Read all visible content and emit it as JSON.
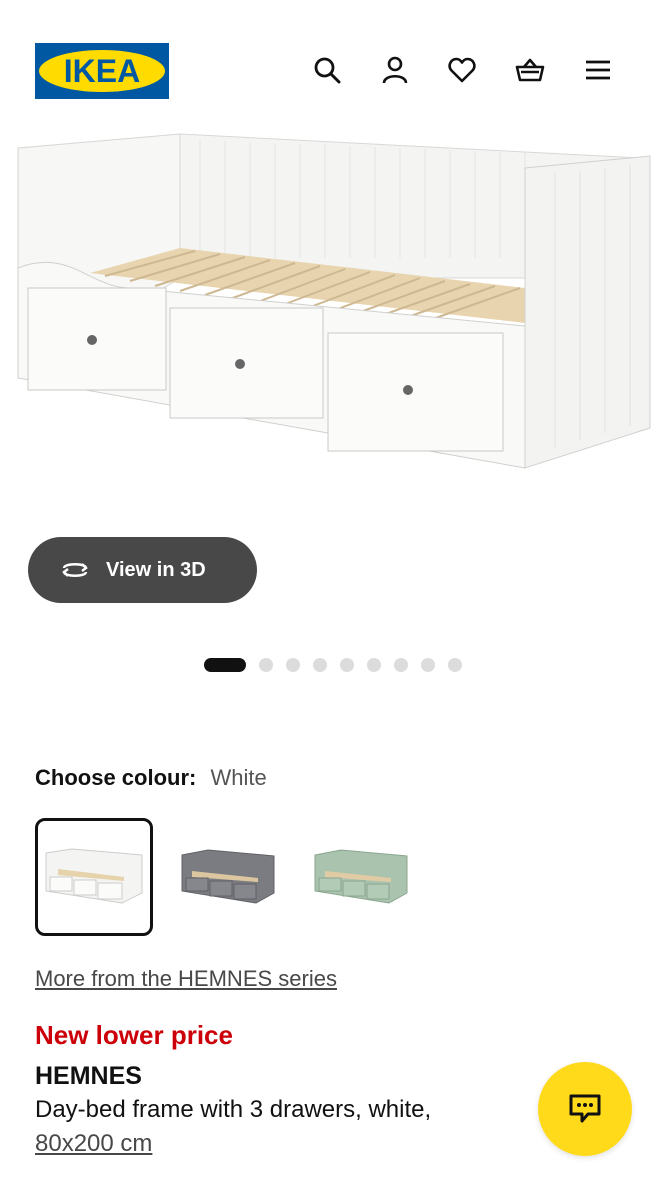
{
  "header": {
    "logo_text": "IKEA",
    "icons": [
      "search-icon",
      "account-icon",
      "heart-icon",
      "basket-icon",
      "menu-icon"
    ]
  },
  "gallery": {
    "view3d_label": "View in 3D",
    "dot_count": 9,
    "active_dot": 1
  },
  "colour": {
    "label": "Choose colour:",
    "selected": "White",
    "options": [
      "White",
      "Grey",
      "Green"
    ]
  },
  "series_link": "More from the HEMNES series",
  "product": {
    "price_tag": "New lower price",
    "name": "HEMNES",
    "description": "Day-bed frame with 3 drawers, white,",
    "size": "80x200 cm"
  },
  "colors": {
    "ikea_blue": "#0058a3",
    "ikea_yellow": "#ffdb00",
    "price_red": "#cc0008",
    "chat_yellow": "#ffda1a",
    "button_dark": "#484848"
  }
}
